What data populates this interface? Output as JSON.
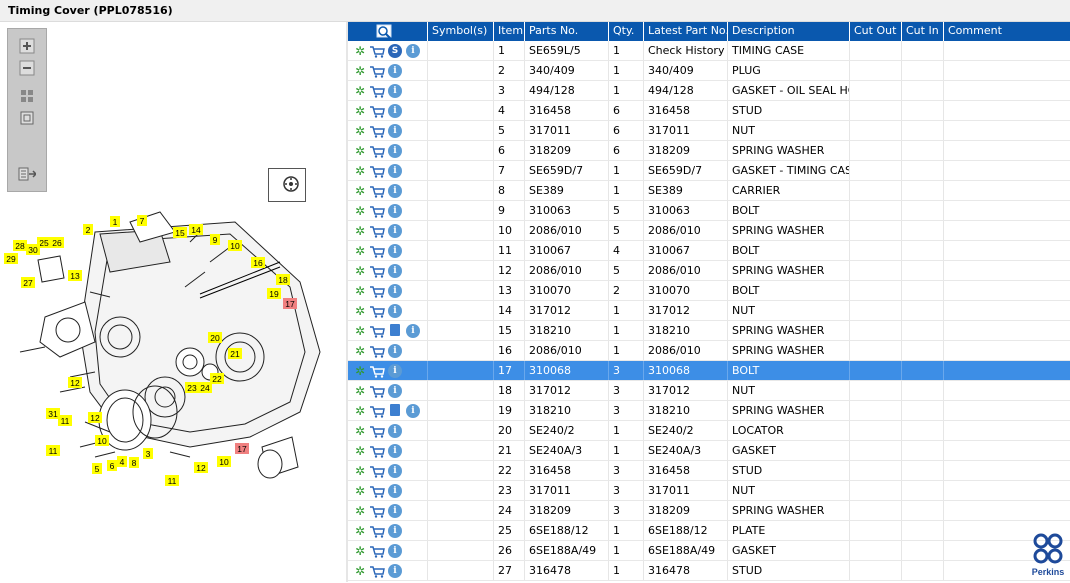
{
  "window": {
    "title": "Timing Cover (PPL078516)"
  },
  "columns": [
    "",
    "Symbol(s)",
    "Item",
    "Parts No.",
    "Qty.",
    "Latest Part No.",
    "Description",
    "Cut Out",
    "Cut In",
    "Comment"
  ],
  "rows": [
    {
      "item": "1",
      "part": "SE659L/5",
      "qty": "1",
      "latest": "Check History",
      "desc": "TIMING CASE",
      "extra": "s"
    },
    {
      "item": "2",
      "part": "340/409",
      "qty": "1",
      "latest": "340/409",
      "desc": "PLUG",
      "extra": ""
    },
    {
      "item": "3",
      "part": "494/128",
      "qty": "1",
      "latest": "494/128",
      "desc": "GASKET - OIL SEAL HOU",
      "extra": ""
    },
    {
      "item": "4",
      "part": "316458",
      "qty": "6",
      "latest": "316458",
      "desc": "STUD",
      "extra": ""
    },
    {
      "item": "5",
      "part": "317011",
      "qty": "6",
      "latest": "317011",
      "desc": "NUT",
      "extra": ""
    },
    {
      "item": "6",
      "part": "318209",
      "qty": "6",
      "latest": "318209",
      "desc": "SPRING WASHER",
      "extra": ""
    },
    {
      "item": "7",
      "part": "SE659D/7",
      "qty": "1",
      "latest": "SE659D/7",
      "desc": "GASKET - TIMING CASE",
      "extra": ""
    },
    {
      "item": "8",
      "part": "SE389",
      "qty": "1",
      "latest": "SE389",
      "desc": "CARRIER",
      "extra": ""
    },
    {
      "item": "9",
      "part": "310063",
      "qty": "5",
      "latest": "310063",
      "desc": "BOLT",
      "extra": ""
    },
    {
      "item": "10",
      "part": "2086/010",
      "qty": "5",
      "latest": "2086/010",
      "desc": "SPRING WASHER",
      "extra": ""
    },
    {
      "item": "11",
      "part": "310067",
      "qty": "4",
      "latest": "310067",
      "desc": "BOLT",
      "extra": ""
    },
    {
      "item": "12",
      "part": "2086/010",
      "qty": "5",
      "latest": "2086/010",
      "desc": "SPRING WASHER",
      "extra": ""
    },
    {
      "item": "13",
      "part": "310070",
      "qty": "2",
      "latest": "310070",
      "desc": "BOLT",
      "extra": ""
    },
    {
      "item": "14",
      "part": "317012",
      "qty": "1",
      "latest": "317012",
      "desc": "NUT",
      "extra": ""
    },
    {
      "item": "15",
      "part": "318210",
      "qty": "1",
      "latest": "318210",
      "desc": "SPRING WASHER",
      "extra": "book"
    },
    {
      "item": "16",
      "part": "2086/010",
      "qty": "1",
      "latest": "2086/010",
      "desc": "SPRING WASHER",
      "extra": ""
    },
    {
      "item": "17",
      "part": "310068",
      "qty": "3",
      "latest": "310068",
      "desc": "BOLT",
      "extra": "",
      "selected": true
    },
    {
      "item": "18",
      "part": "317012",
      "qty": "3",
      "latest": "317012",
      "desc": "NUT",
      "extra": ""
    },
    {
      "item": "19",
      "part": "318210",
      "qty": "3",
      "latest": "318210",
      "desc": "SPRING WASHER",
      "extra": "book"
    },
    {
      "item": "20",
      "part": "SE240/2",
      "qty": "1",
      "latest": "SE240/2",
      "desc": "LOCATOR",
      "extra": ""
    },
    {
      "item": "21",
      "part": "SE240A/3",
      "qty": "1",
      "latest": "SE240A/3",
      "desc": "GASKET",
      "extra": ""
    },
    {
      "item": "22",
      "part": "316458",
      "qty": "3",
      "latest": "316458",
      "desc": "STUD",
      "extra": ""
    },
    {
      "item": "23",
      "part": "317011",
      "qty": "3",
      "latest": "317011",
      "desc": "NUT",
      "extra": ""
    },
    {
      "item": "24",
      "part": "318209",
      "qty": "3",
      "latest": "318209",
      "desc": "SPRING WASHER",
      "extra": ""
    },
    {
      "item": "25",
      "part": "6SE188/12",
      "qty": "1",
      "latest": "6SE188/12",
      "desc": "PLATE",
      "extra": ""
    },
    {
      "item": "26",
      "part": "6SE188A/49",
      "qty": "1",
      "latest": "6SE188A/49",
      "desc": "GASKET",
      "extra": ""
    },
    {
      "item": "27",
      "part": "316478",
      "qty": "1",
      "latest": "316478",
      "desc": "STUD",
      "extra": ""
    }
  ],
  "diagram_labels": [
    "1",
    "2",
    "3",
    "4",
    "5",
    "6",
    "7",
    "8",
    "9",
    "10",
    "10",
    "11",
    "11",
    "11",
    "12",
    "12",
    "12",
    "13",
    "14",
    "15",
    "16",
    "17",
    "17",
    "18",
    "19",
    "20",
    "21",
    "22",
    "23",
    "24",
    "25",
    "26",
    "27",
    "28",
    "29",
    "30",
    "31"
  ],
  "brand": {
    "name": "Perkins"
  },
  "colors": {
    "header": "#0a58ae",
    "selected": "#3d8ee6",
    "label": "#ffff00",
    "label_hl": "#f08080"
  }
}
